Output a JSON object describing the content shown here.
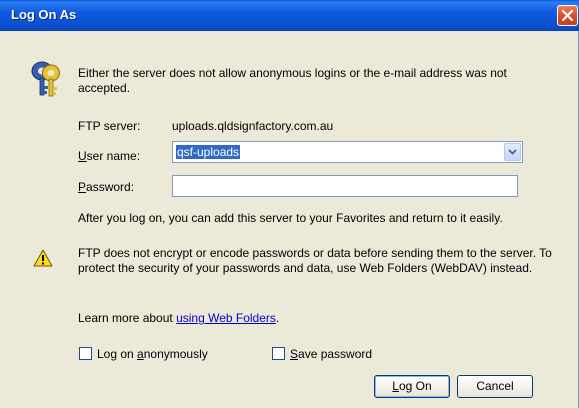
{
  "window": {
    "title": "Log On As",
    "close_icon": "close-icon"
  },
  "message": "Either the server does not allow anonymous logins or the e-mail address was not accepted.",
  "ftp_server": {
    "label": "FTP server:",
    "value": "uploads.qldsignfactory.com.au"
  },
  "user_name": {
    "label_accel": "U",
    "label_rest": "ser name:",
    "value": "qsf-uploads"
  },
  "password": {
    "label_accel": "P",
    "label_rest": "assword:",
    "value": ""
  },
  "after_logon_text": "After you log on, you can add this server to your Favorites and return to it easily.",
  "warning_text": "FTP does not encrypt or encode passwords or data before sending them to the server.  To protect the security of your passwords and data, use Web Folders (WebDAV) instead.",
  "learn_more": {
    "prefix": "Learn more about ",
    "link": "using Web Folders",
    "suffix": "."
  },
  "options": {
    "anonymous": {
      "label_pre": "Log on ",
      "label_accel": "a",
      "label_post": "nonymously",
      "checked": false
    },
    "save_password": {
      "label_accel": "S",
      "label_post": "ave password",
      "checked": false
    }
  },
  "buttons": {
    "logon_accel": "L",
    "logon_rest": "og On",
    "cancel": "Cancel"
  },
  "colors": {
    "titlebar": "#0b4fd1",
    "dialog_bg": "#ece9d8",
    "selection": "#316ac5",
    "link": "#0000cc",
    "close_button": "#d2512c"
  },
  "icons": [
    "keys-icon",
    "warning-icon",
    "close-icon",
    "chevron-down-icon"
  ]
}
